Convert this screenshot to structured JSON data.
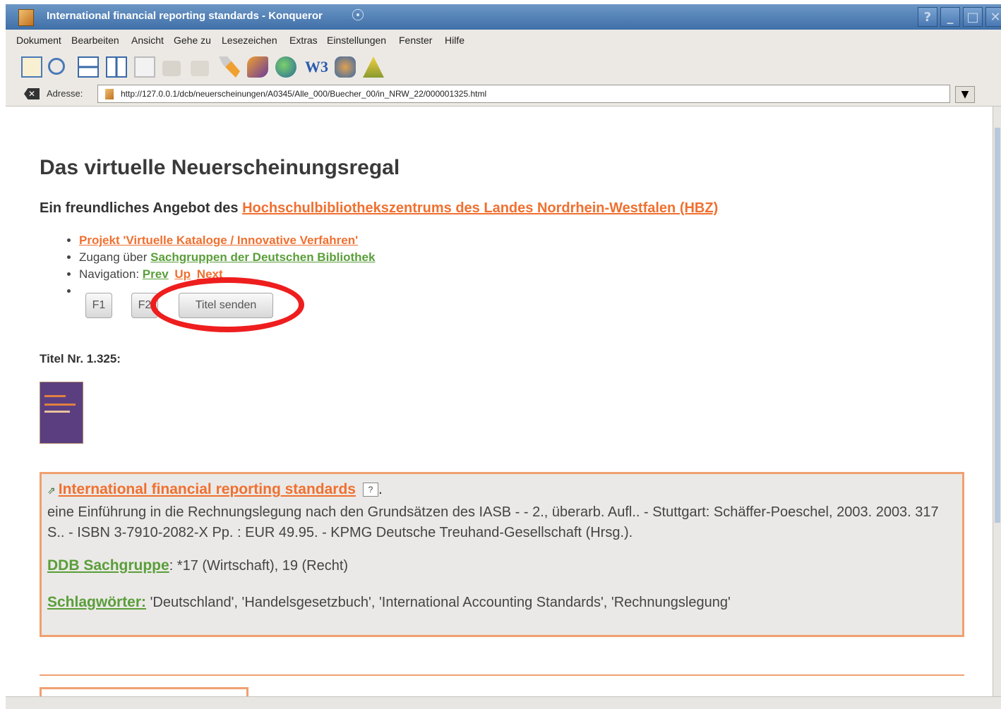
{
  "window": {
    "title": "International financial reporting standards - Konqueror",
    "buttons": [
      "?",
      "_",
      "□",
      "✕"
    ]
  },
  "menu": [
    "Dokument",
    "Bearbeiten",
    "Ansicht",
    "Gehe zu",
    "Lesezeichen",
    "Extras",
    "Einstellungen",
    "Fenster",
    "Hilfe"
  ],
  "toolbar": {
    "icons": [
      "view-icon",
      "find-icon",
      "split-horizontal-icon",
      "split-vertical-icon",
      "frame-icon",
      "image-disabled-icon",
      "link-disabled-icon",
      "wrench-icon",
      "tools-icon",
      "globe-icon",
      "w3c-validator-icon",
      "translate-icon",
      "bell-icon"
    ],
    "w3_label": "W3"
  },
  "address": {
    "label": "Adresse:",
    "url": "http://127.0.0.1/dcb/neuerscheinungen/A0345/Alle_000/Buecher_00/in_NRW_22/000001325.html"
  },
  "page": {
    "title": "Das virtuelle Neuerscheinungsregal",
    "subtitle_prefix": "Ein freundliches Angebot des ",
    "subtitle_link": "Hochschulbibliothekszentrums des Landes Nordrhein-Westfalen (HBZ)",
    "nav": {
      "item1_link": "Projekt 'Virtuelle Kataloge / Innovative Verfahren'",
      "item2_prefix": "Zugang über ",
      "item2_link": "Sachgruppen der Deutschen Bibliothek",
      "item3_prefix": "Navigation: ",
      "prev": "Prev",
      "up": "Up",
      "next": "Next"
    },
    "buttons": {
      "f1": "F1",
      "f2": "F2",
      "send": "Titel senden"
    },
    "titel_nr": "Titel Nr. 1.325:",
    "record": {
      "title": "International financial reporting standards",
      "help": "?",
      "after_help": ".",
      "description": "eine Einführung in die Rechnungslegung nach den Grundsätzen des IASB - - 2., überarb. Aufl.. - Stuttgart: Schäffer-Poeschel, 2003. 2003. 317 S.. - ISBN 3-7910-2082-X Pp. : EUR 49.95. - KPMG Deutsche Treuhand-Gesellschaft (Hrsg.).",
      "ddb_label": "DDB Sachgruppe",
      "ddb_value": ": *17 (Wirtschaft), 19 (Recht)",
      "schlag_label": "Schlagwörter:",
      "schlag_value": " 'Deutschland', 'Handelsgesetzbuch', 'International Accounting Standards', 'Rechnungslegung'"
    }
  },
  "colors": {
    "link_orange": "#f07030",
    "link_green": "#5a9e3a",
    "annotation_red": "#ee1e1e",
    "titlebar_blue": "#4f7fb8"
  }
}
